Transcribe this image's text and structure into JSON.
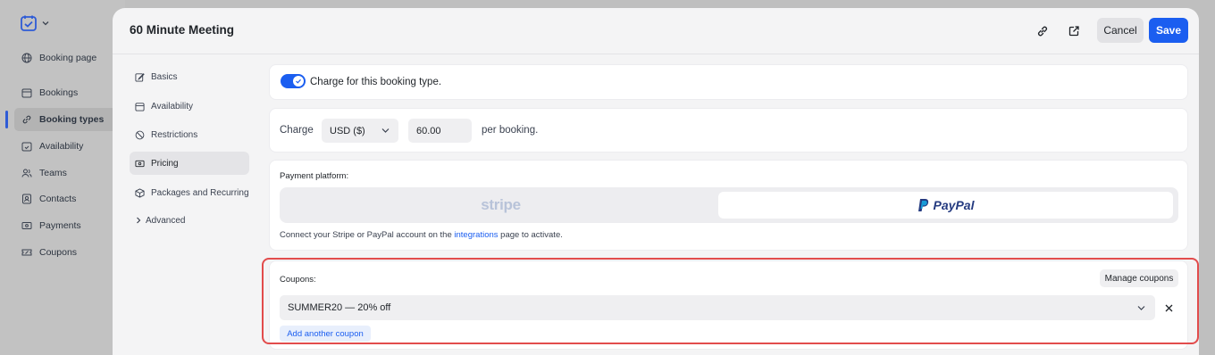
{
  "app_sidebar": {
    "items": [
      {
        "label": "Booking page",
        "icon": "globe-icon"
      },
      {
        "label": "Bookings",
        "icon": "calendar-icon"
      },
      {
        "label": "Booking types",
        "icon": "link-icon"
      },
      {
        "label": "Availability",
        "icon": "calendar-check-icon"
      },
      {
        "label": "Teams",
        "icon": "users-icon"
      },
      {
        "label": "Contacts",
        "icon": "contact-icon"
      },
      {
        "label": "Payments",
        "icon": "payment-icon"
      },
      {
        "label": "Coupons",
        "icon": "coupon-icon"
      }
    ],
    "active": "Booking types"
  },
  "modal": {
    "title": "60 Minute Meeting",
    "cancel_label": "Cancel",
    "save_label": "Save",
    "accent": "#1b5ef0"
  },
  "modal_nav": {
    "items": [
      {
        "label": "Basics",
        "icon": "edit-icon"
      },
      {
        "label": "Availability",
        "icon": "calendar-icon"
      },
      {
        "label": "Restrictions",
        "icon": "ban-icon"
      },
      {
        "label": "Pricing",
        "icon": "price-tag-icon"
      },
      {
        "label": "Packages and Recurring",
        "icon": "package-icon"
      },
      {
        "label": "Advanced",
        "icon": "chevron-right-icon"
      }
    ],
    "active": "Pricing"
  },
  "pricing": {
    "charge_toggle_label": "Charge for this booking type.",
    "charge_toggle_on": true,
    "charge_label": "Charge",
    "currency": "USD ($)",
    "amount": "60.00",
    "per_booking": "per booking."
  },
  "payment": {
    "label": "Payment platform:",
    "stripe": "stripe",
    "paypal": "PayPal",
    "selected": "PayPal",
    "note_prefix": "Connect your Stripe or PayPal account on the ",
    "note_link": "integrations",
    "note_suffix": " page to activate."
  },
  "coupons": {
    "label": "Coupons:",
    "manage_label": "Manage coupons",
    "selected": "SUMMER20 — 20% off",
    "add_label": "Add another coupon",
    "highlight_color": "#e24c4c"
  }
}
